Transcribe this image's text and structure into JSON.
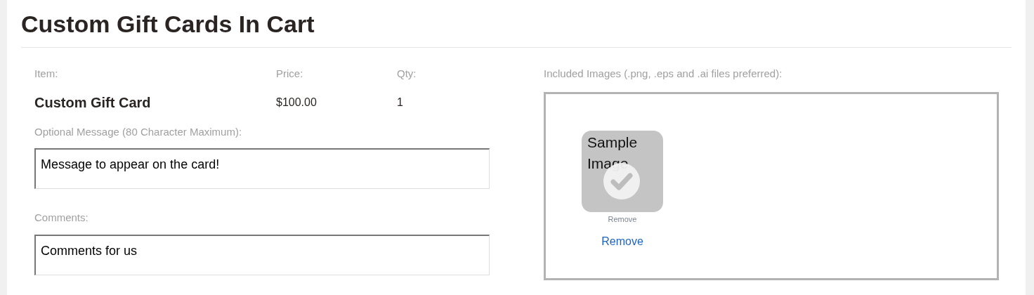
{
  "title": "Custom Gift Cards In Cart",
  "item": {
    "headers": [
      "Item:",
      "Price:",
      "Qty:"
    ],
    "name": "Custom Gift Card",
    "price": "$100.00",
    "qty": "1"
  },
  "message": {
    "label": "Optional Message (80 Character Maximum):",
    "value": "Message to appear on the card!"
  },
  "comments": {
    "label": "Comments:",
    "value": "Comments for us"
  },
  "images": {
    "label": "Included Images (.png, .eps and .ai files preferred):",
    "items": [
      {
        "thumbnail_text": "Sample Image",
        "thumbnail_caption": "Remove",
        "checked": true,
        "remove_link": "Remove"
      }
    ]
  }
}
